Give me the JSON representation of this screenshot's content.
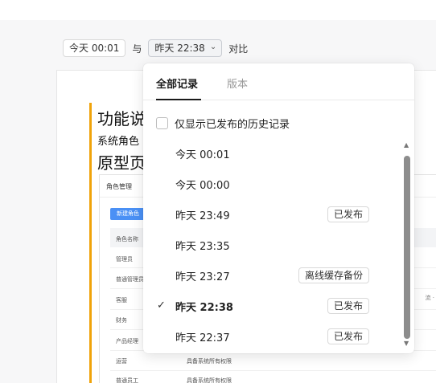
{
  "compare_bar": {
    "from_label": "今天 00:01",
    "connector": "与",
    "to_label": "昨天 22:38",
    "to_chevron_icon": "chevron-down-icon",
    "suffix": "对比"
  },
  "document": {
    "heading_function": "功能说",
    "subtitle": "系统角色",
    "heading_prototype": "原型页",
    "prototype": {
      "title": "角色管理",
      "new_button": "新建角色",
      "column_header": "角色名称",
      "rows": [
        "管理员",
        "普通管理员",
        "客服",
        "财务",
        "产品经理",
        "运营",
        "普通员工"
      ],
      "permission_text": "具备系统所有权限",
      "right_fragment": "流 ·",
      "accent_color": "#f0a30a",
      "button_color": "#4a90f5"
    }
  },
  "popover": {
    "tabs": [
      {
        "label": "全部记录",
        "active": true
      },
      {
        "label": "版本",
        "active": false
      }
    ],
    "filter_label": "仅显示已发布的历史记录",
    "filter_checked": false,
    "selected_icon": "check-icon",
    "records": [
      {
        "time": "今天 00:01",
        "badge": "",
        "selected": false
      },
      {
        "time": "今天 00:00",
        "badge": "",
        "selected": false
      },
      {
        "time": "昨天 23:49",
        "badge": "已发布",
        "selected": false
      },
      {
        "time": "昨天 23:35",
        "badge": "",
        "selected": false
      },
      {
        "time": "昨天 23:27",
        "badge": "离线缓存备份",
        "selected": false
      },
      {
        "time": "昨天 22:38",
        "badge": "已发布",
        "selected": true
      },
      {
        "time": "昨天 22:37",
        "badge": "已发布",
        "selected": false
      }
    ],
    "scroll_up_icon": "triangle-up-icon",
    "scroll_down_icon": "triangle-down-icon"
  }
}
